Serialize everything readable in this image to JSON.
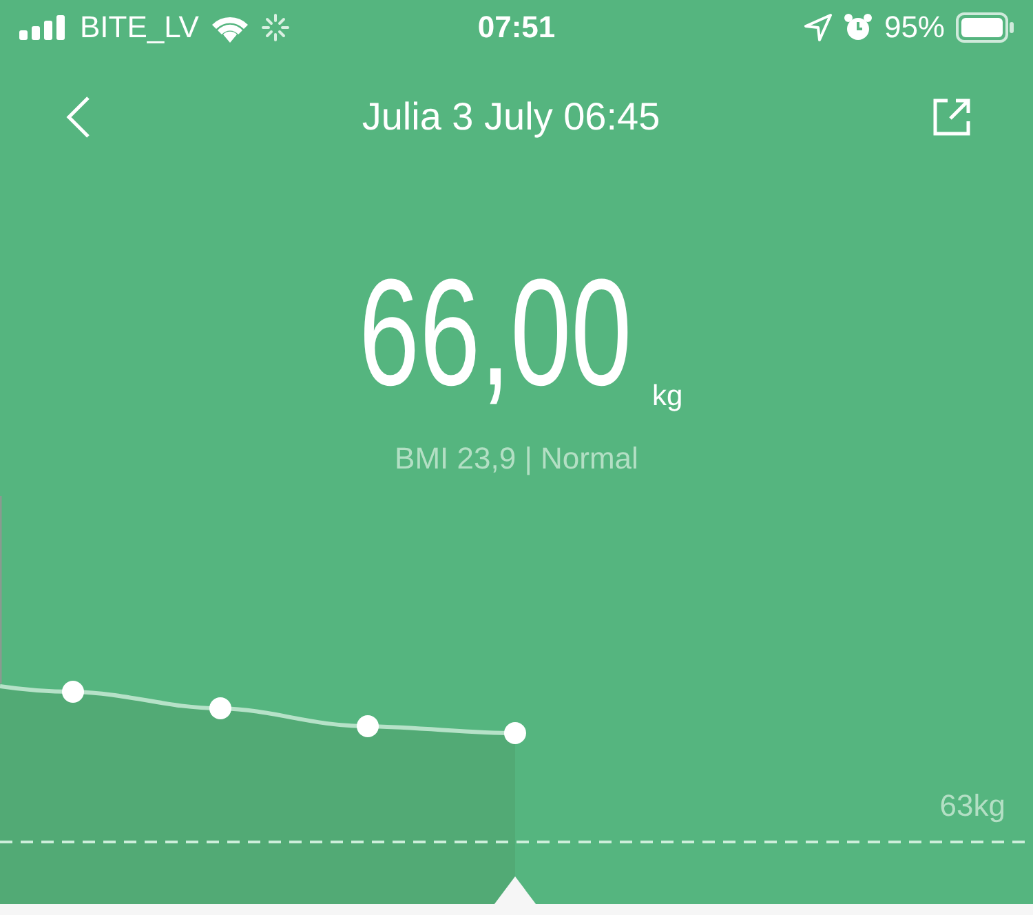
{
  "status_bar": {
    "carrier": "BITE_LV",
    "time": "07:51",
    "battery": "95%"
  },
  "header": {
    "title": "Julia 3 July 06:45"
  },
  "reading": {
    "value": "66,00",
    "unit": "kg",
    "bmi": "BMI 23,9 | Normal"
  },
  "trend": {
    "target_label": "63kg"
  }
}
